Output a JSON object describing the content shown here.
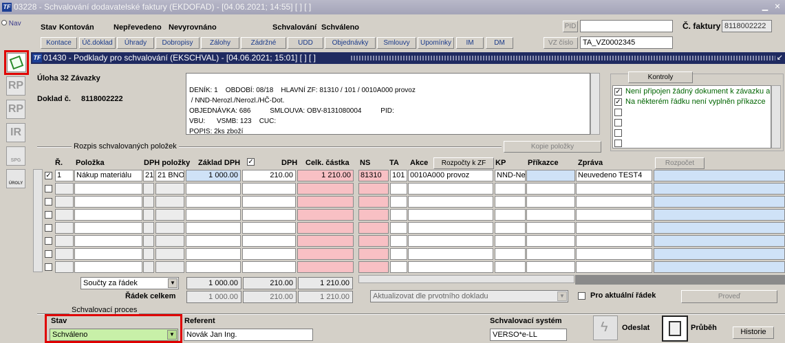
{
  "window": {
    "title": "03228 - Schvalování dodavatelské faktury (EKDOFAD) - [04.06.2021; 14:55]  [ ]  [ ]",
    "icon": "TF"
  },
  "nav": {
    "label": "Nav"
  },
  "header": {
    "stav_label": "Stav",
    "stav_value": "Kontován",
    "neprevedeno_label": "Nepřevedeno",
    "neprevedeno_value": "Nevyrovnáno",
    "schvalovani_label": "Schvalování",
    "schvalovani_value": "Schváleno",
    "pid_label": "PID",
    "pid_value": "",
    "cislo_label": "Č. faktury",
    "cislo_value": "8118002222",
    "vz_label": "VZ číslo",
    "vz_value": "TA_VZ0002345"
  },
  "toolbar": {
    "buttons": [
      "Kontace",
      "Úč.doklad",
      "Úhrady",
      "Dobropisy",
      "Zálohy",
      "Zádržné",
      "UDD",
      "Objednávky",
      "Smlouvy",
      "Upomínky",
      "IM",
      "DM"
    ]
  },
  "subwindow": {
    "title": "01430 - Podklady pro schvalování (EKSCHVAL) - [04.06.2021; 15:01]  [ ]  [ ]"
  },
  "side_tools": [
    "RP",
    "RP",
    "IR",
    "SPG",
    "ÚROLY"
  ],
  "uloha": {
    "label": "Úloha 32 Závazky",
    "doklad_label": "Doklad č.",
    "doklad_value": "8118002222"
  },
  "info_text": {
    "line1": "DENÍK: 1    OBDOBÍ: 08/18    HLAVNÍ ZF: 81310 / 101 / 0010A000 provoz",
    "line2": " / NND-Nerozl./Nerozl./HČ-Dot.",
    "line3": "OBJEDNÁVKA: 686          SMLOUVA: OBV-8131080004          PID:",
    "line4": "VBU:      VSMB: 123    CUC:",
    "line5": "POPIS: 2ks zboží"
  },
  "kontroly": {
    "button": "Kontroly",
    "items": [
      "Není připojen žádný dokument k závazku an",
      "Na některém řádku není vyplněn příkazce"
    ]
  },
  "rozpis": {
    "legend": "Rozpis schvalovaných položek",
    "kopie_button": "Kopie položky"
  },
  "table": {
    "headers": {
      "r": "Ř.",
      "polozka": "Položka",
      "dph_polozky": "DPH položky",
      "zaklad": "Základ DPH",
      "dph": "DPH",
      "celk": "Celk. částka",
      "ns": "NS",
      "ta": "TA",
      "akce": "Akce",
      "kp": "KP",
      "prikazce": "Příkazce",
      "zprava": "Zpráva"
    },
    "rozpocty_button": "Rozpočty k ZF",
    "rozpocet_button": "Rozpočet",
    "row1": {
      "r": "1",
      "polozka": "Nákup materiálu",
      "dph1": "21",
      "dph2": "21  BNO",
      "zaklad": "1 000.00",
      "dph": "210.00",
      "celk": "1 210.00",
      "ns": "81310",
      "ta": "101",
      "akce": "0010A000 provoz",
      "kp": "NND-Nero",
      "prikazce": "",
      "zprava": "Neuvedeno TEST4"
    }
  },
  "totals": {
    "soucty_select": "Součty za řádek",
    "zaklad": "1 000.00",
    "dph": "210.00",
    "celk": "1 210.00",
    "radek_label": "Řádek celkem",
    "r_zaklad": "1 000.00",
    "r_dph": "210.00",
    "r_celk": "1 210.00",
    "aktualizovat": "Aktualizovat dle prvotního dokladu",
    "pro_aktualni": "Pro aktuální řádek",
    "proved": "Proveď"
  },
  "proces": {
    "legend": "Schvalovací proces",
    "stav_label": "Stav",
    "stav_value": "Schváleno",
    "referent_label": "Referent",
    "referent_value": "Novák Jan Ing.",
    "system_label": "Schvalovací systém",
    "system_value": "VERSO*e-LL",
    "odeslat": "Odeslat",
    "pruben": "Průběh",
    "historie": "Historie"
  },
  "colors": {
    "accent_red": "#e00000",
    "title_dark": "#1f2a60",
    "ok_green": "#006400"
  }
}
